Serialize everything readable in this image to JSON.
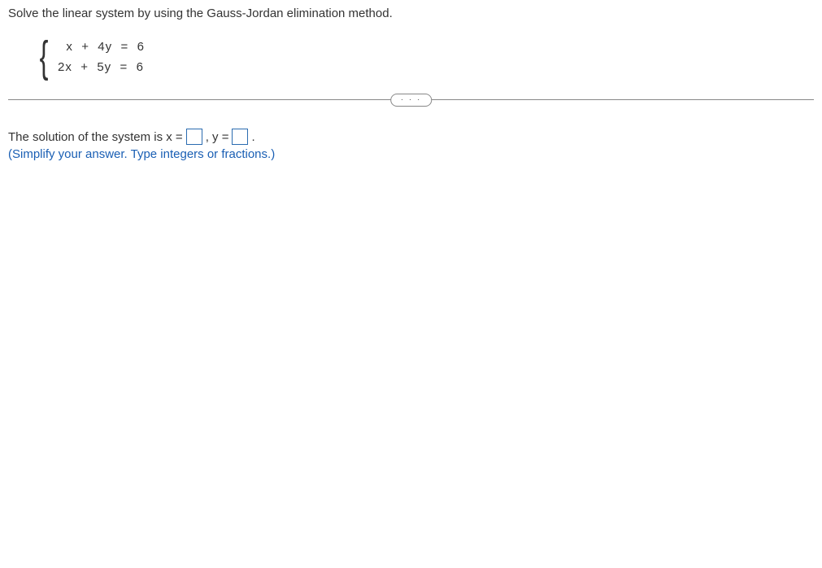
{
  "question": {
    "prompt": "Solve the linear system by using the Gauss-Jordan elimination method.",
    "eq1": "  x  +  4y  =  6",
    "eq2": "2x  +  5y  =  6"
  },
  "divider": {
    "ellipsis": "· · ·"
  },
  "answer": {
    "prefix": "The solution of the system is x =",
    "mid": ", y =",
    "suffix": ".",
    "instruction": "(Simplify your answer. Type integers or fractions.)"
  }
}
